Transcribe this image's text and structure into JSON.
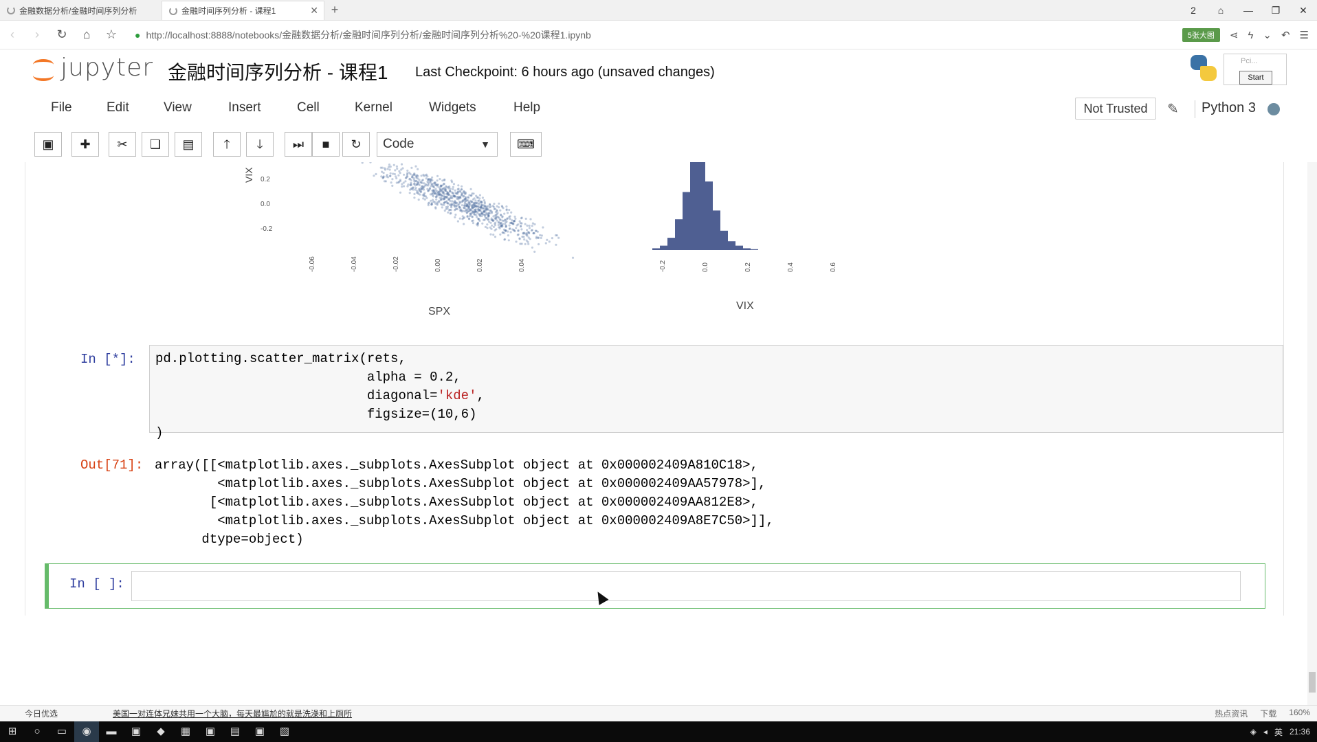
{
  "browser": {
    "tabs": [
      {
        "title": "金融数据分析/金融时间序列分析"
      },
      {
        "title": "金融时间序列分析 - 课程1"
      }
    ],
    "url": "http://localhost:8888/notebooks/金融数据分析/金融时间序列分析/金融时间序列分析%20-%20课程1.ipynb",
    "address_badge": "5张大图",
    "tab_count": "2"
  },
  "jupyter": {
    "logo_text": "jupyter",
    "notebook_title": "金融时间序列分析 - 课程1",
    "checkpoint": "Last Checkpoint: 6 hours ago (unsaved changes)",
    "popup_text": "Pci...",
    "popup_button": "Start",
    "menu": [
      "File",
      "Edit",
      "View",
      "Insert",
      "Cell",
      "Kernel",
      "Widgets",
      "Help"
    ],
    "trust_status": "Not Trusted",
    "kernel_name": "Python 3",
    "cell_type": "Code"
  },
  "plots": {
    "scatter_ylabel": "VIX",
    "scatter_yticks": [
      "0.2",
      "0.0",
      "-0.2"
    ],
    "scatter_xticks": [
      "-0.06",
      "-0.04",
      "-0.02",
      "0.00",
      "0.02",
      "0.04"
    ],
    "scatter_xlabel": "SPX",
    "hist_xticks": [
      "-0.2",
      "0.0",
      "0.2",
      "0.4",
      "0.6"
    ],
    "hist_xlabel": "VIX",
    "hist_values": [
      0.02,
      0.05,
      0.14,
      0.35,
      0.66,
      1.0,
      1.0,
      0.78,
      0.45,
      0.22,
      0.1,
      0.05,
      0.02,
      0.01
    ]
  },
  "cells": {
    "in_prompt": "In  [*]:",
    "code_lines": [
      "pd.plotting.scatter_matrix(rets,",
      "                           alpha = 0.2,",
      "                           diagonal=",
      "                           figsize=(10,6)",
      ")"
    ],
    "code_string": "'kde'",
    "code_tail": ",",
    "out_prompt": "Out[71]:",
    "output_lines": [
      "array([[<matplotlib.axes._subplots.AxesSubplot object at 0x000002409A810C18>,",
      "        <matplotlib.axes._subplots.AxesSubplot object at 0x000002409AA57978>],",
      "       [<matplotlib.axes._subplots.AxesSubplot object at 0x000002409AA812E8>,",
      "        <matplotlib.axes._subplots.AxesSubplot object at 0x000002409A8E7C50>]],",
      "      dtype=object)"
    ],
    "empty_prompt": "In  [ ]:"
  },
  "statusbar": {
    "left": "今日优选",
    "news": "美国一对连体兄妹共用一个大脑，每天最尴尬的就是洗澡和上厕所",
    "right_items": [
      "热点资讯",
      "下载",
      "160%"
    ]
  },
  "taskbar": {
    "ime": "英",
    "clock": "21:36"
  }
}
